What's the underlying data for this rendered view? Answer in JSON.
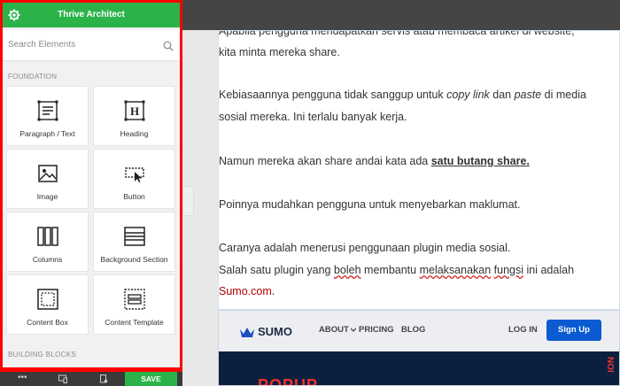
{
  "app": {
    "title": "Thrive Architect"
  },
  "search": {
    "placeholder": "Search Elements"
  },
  "sections": {
    "foundation": "FOUNDATION",
    "building_blocks": "BUILDING BLOCKS"
  },
  "elements": [
    {
      "label": "Paragraph / Text",
      "icon": "paragraph-icon"
    },
    {
      "label": "Heading",
      "icon": "heading-icon"
    },
    {
      "label": "Image",
      "icon": "image-icon"
    },
    {
      "label": "Button",
      "icon": "button-icon"
    },
    {
      "label": "Columns",
      "icon": "columns-icon"
    },
    {
      "label": "Background Section",
      "icon": "background-section-icon"
    },
    {
      "label": "Content Box",
      "icon": "content-box-icon"
    },
    {
      "label": "Content Template",
      "icon": "content-template-icon"
    }
  ],
  "bottombar": {
    "more": "•••",
    "save_label": "SAVE"
  },
  "content": {
    "p1_line1": "Apabila pengguna mendapatkan servis atau membaca artikel di website,",
    "p1_line2": "kita minta mereka share.",
    "p2_a": "Kebiasaannya pengguna tidak sanggup untuk ",
    "p2_b": "copy link",
    "p2_c": " dan ",
    "p2_d": "paste",
    "p2_e": " di media",
    "p2_line2": "sosial mereka. Ini terlalu banyak kerja.",
    "p3_a": "Namun mereka akan share andai kata ada ",
    "p3_b": "satu butang share.",
    "p4": "Poinnya mudahkan pengguna untuk menyebarkan maklumat.",
    "p5_line1": "Caranya adalah menerusi penggunaan plugin media sosial.",
    "p5_a": "Salah satu plugin yang ",
    "p5_b": "boleh",
    "p5_c": " membantu ",
    "p5_d": "melaksanakan",
    "p5_e": " ",
    "p5_f": "fungsi",
    "p5_g": " ini adalah",
    "p5_link": "Sumo.com",
    "p5_end": "."
  },
  "sumo": {
    "logo": "SUMO",
    "nav": [
      "ABOUT",
      "PRICING",
      "BLOG"
    ],
    "login": "LOG IN",
    "signup": "Sign Up",
    "hero_text": "POPUP",
    "side_text": "NOI"
  },
  "colors": {
    "accent_green": "#2bb34a",
    "highlight_red": "#ff0000",
    "sumo_blue": "#0a5bd1",
    "sumo_navy": "#0b1f3f",
    "popup_red": "#f0312f"
  }
}
